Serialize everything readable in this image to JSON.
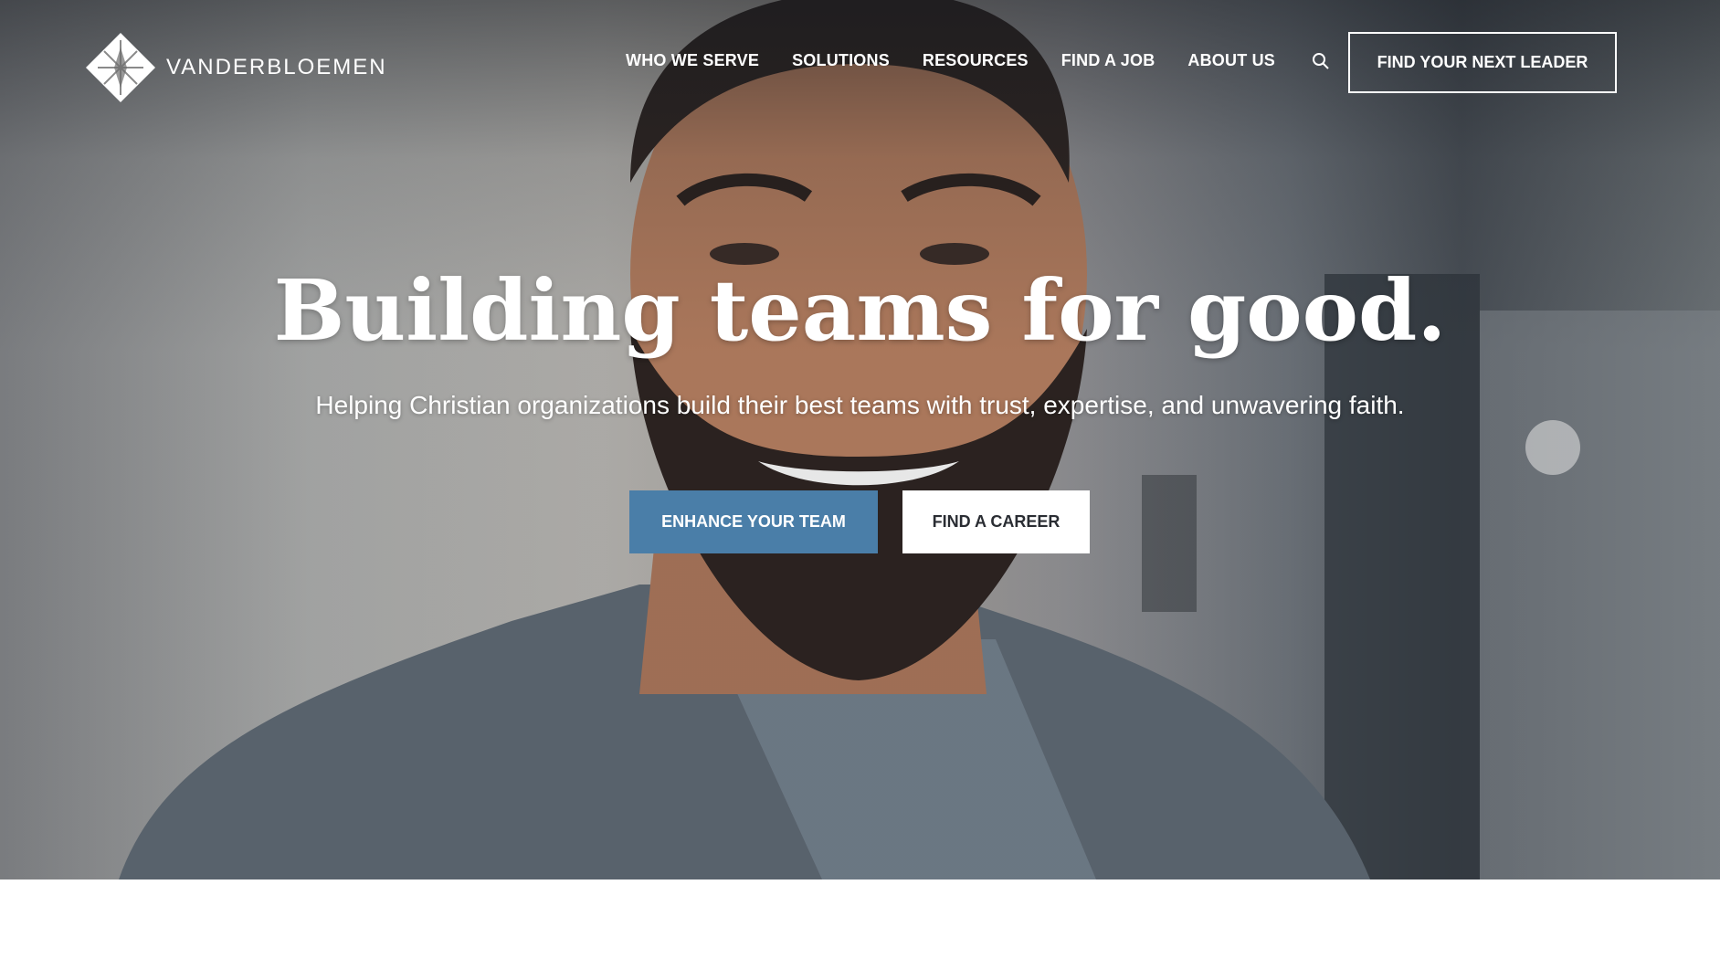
{
  "brand": {
    "name": "VANDERBLOEMEN"
  },
  "nav": {
    "items": [
      "WHO WE SERVE",
      "SOLUTIONS",
      "RESOURCES",
      "FIND A JOB",
      "ABOUT US"
    ],
    "search_icon": "search-icon",
    "cta": "FIND YOUR NEXT LEADER"
  },
  "hero": {
    "headline": "Building teams for good.",
    "subheadline": "Helping Christian organizations build their best teams with trust, expertise, and unwavering faith.",
    "primary_button": "ENHANCE YOUR TEAM",
    "secondary_button": "FIND A CAREER"
  },
  "colors": {
    "accent": "#4a7ea8",
    "white": "#ffffff"
  }
}
